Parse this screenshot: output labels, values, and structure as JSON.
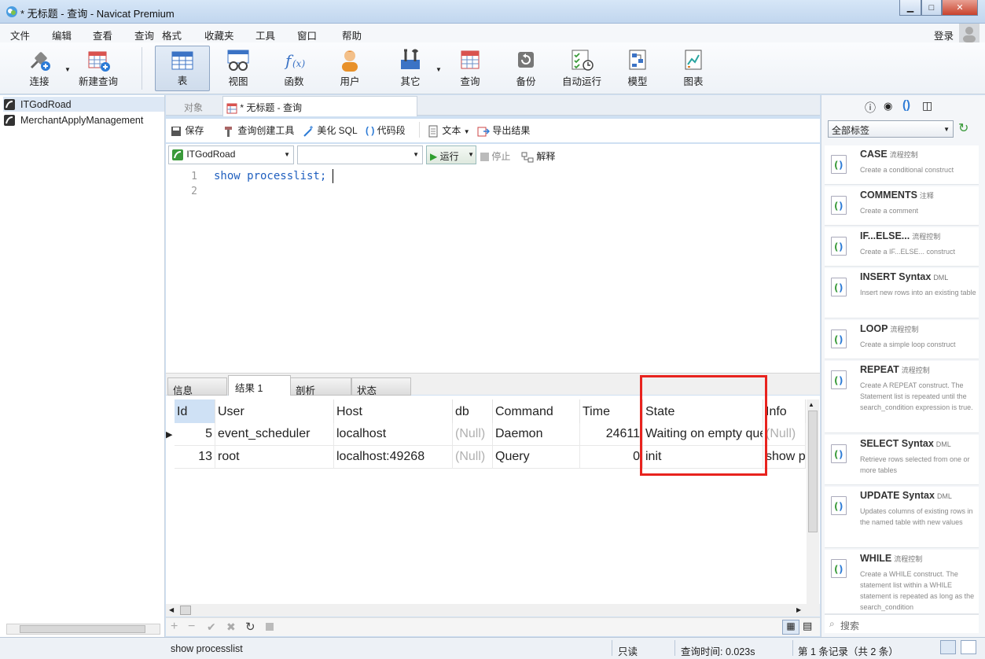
{
  "window": {
    "title": "* 无标题 - 查询 - Navicat Premium",
    "login": "登录"
  },
  "menu": [
    "文件",
    "编辑",
    "查看",
    "查询",
    "格式",
    "收藏夹",
    "工具",
    "窗口",
    "帮助"
  ],
  "toolbar": {
    "connect": "连接",
    "new_query": "新建查询",
    "table": "表",
    "view": "视图",
    "function": "函数",
    "user": "用户",
    "other": "其它",
    "query": "查询",
    "backup": "备份",
    "auto_run": "自动运行",
    "model": "模型",
    "chart": "图表"
  },
  "sidebar": {
    "items": [
      "ITGodRoad",
      "MerchantApplyManagement"
    ]
  },
  "tabs": {
    "objects": "对象",
    "query_tab": "* 无标题 - 查询"
  },
  "query_toolbar": {
    "save": "保存",
    "query_builder": "查询创建工具",
    "beautify": "美化 SQL",
    "snippet": "代码段",
    "text": "文本",
    "export": "导出结果",
    "database": "ITGodRoad",
    "run": "运行",
    "stop": "停止",
    "explain": "解释"
  },
  "editor": {
    "line_numbers": [
      "1",
      "2"
    ],
    "code": "show processlist;"
  },
  "result_tabs": [
    "信息",
    "结果 1",
    "剖析",
    "状态"
  ],
  "grid": {
    "columns": [
      "Id",
      "User",
      "Host",
      "db",
      "Command",
      "Time",
      "State",
      "Info"
    ],
    "rows": [
      [
        "5",
        "event_scheduler",
        "localhost",
        "(Null)",
        "Daemon",
        "24611",
        "Waiting on empty queue",
        "(Null)"
      ],
      [
        "13",
        "root",
        "localhost:49268",
        "(Null)",
        "Query",
        "0",
        "init",
        "show processlist"
      ]
    ]
  },
  "right_panel": {
    "filter": "全部标签",
    "search_placeholder": "搜索",
    "snippets": [
      {
        "title": "CASE",
        "tag": "流程控制",
        "desc": "Create a conditional construct"
      },
      {
        "title": "COMMENTS",
        "tag": "注释",
        "desc": "Create a comment"
      },
      {
        "title": "IF...ELSE...",
        "tag": "流程控制",
        "desc": "Create a IF...ELSE... construct"
      },
      {
        "title": "INSERT Syntax",
        "tag": "DML",
        "desc": "Insert new rows into an existing table"
      },
      {
        "title": "LOOP",
        "tag": "流程控制",
        "desc": "Create a simple loop construct"
      },
      {
        "title": "REPEAT",
        "tag": "流程控制",
        "desc": "Create A REPEAT construct. The Statement list is repeated until the search_condition expression is true."
      },
      {
        "title": "SELECT Syntax",
        "tag": "DML",
        "desc": "Retrieve rows selected from one or more tables"
      },
      {
        "title": "UPDATE Syntax",
        "tag": "DML",
        "desc": "Updates columns of existing rows in the named table with new values"
      },
      {
        "title": "WHILE",
        "tag": "流程控制",
        "desc": "Create a WHILE construct. The statement list within a WHILE statement is repeated as long as the search_condition"
      }
    ]
  },
  "status": {
    "sql": "show processlist",
    "readonly": "只读",
    "query_time": "查询时间: 0.023s",
    "records": "第 1 条记录（共 2 条）"
  },
  "colors": {
    "highlight": "#e8231e",
    "accent": "#2d7bd6"
  }
}
